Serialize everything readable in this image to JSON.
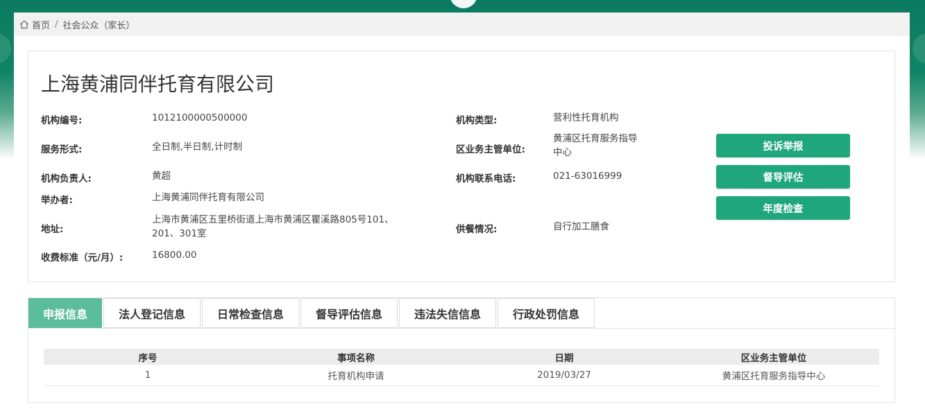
{
  "breadcrumb": {
    "home": "首页",
    "separator": "/",
    "current": "社会公众（家长）"
  },
  "org": {
    "name": "上海黄浦同伴托育有限公司",
    "fields_left": [
      {
        "label": "机构编号:",
        "value": "1012100000500000"
      },
      {
        "label": "服务形式:",
        "value": "全日制,半日制,计时制"
      },
      {
        "label": "机构负责人:",
        "value": "黄超"
      },
      {
        "label": "举办者:",
        "value": "上海黄浦同伴托育有限公司"
      },
      {
        "label": "地址:",
        "value_line1": "上海市黄浦区五里桥街道上海市黄浦区瞿溪路805号101、",
        "value_line2": "201、301室"
      },
      {
        "label": "收费标准（元/月）:",
        "value": "16800.00"
      }
    ],
    "fields_right": [
      {
        "label": "机构类型:",
        "value": "营利性托育机构"
      },
      {
        "label": "区业务主管单位:",
        "value_line1": "黄浦区托育服务指导",
        "value_line2": "中心"
      },
      {
        "label": "机构联系电话:",
        "value": "021-63016999"
      },
      {
        "label": "供餐情况:",
        "value": "自行加工膳食"
      }
    ]
  },
  "actions": {
    "complaint": "投诉举报",
    "supervision": "督导评估",
    "annual": "年度检查"
  },
  "tabs": [
    {
      "label": "申报信息",
      "active": true
    },
    {
      "label": "法人登记信息",
      "active": false
    },
    {
      "label": "日常检查信息",
      "active": false
    },
    {
      "label": "督导评估信息",
      "active": false
    },
    {
      "label": "违法失信信息",
      "active": false
    },
    {
      "label": "行政处罚信息",
      "active": false
    }
  ],
  "table": {
    "headers": [
      "序号",
      "事项名称",
      "日期",
      "区业务主管单位"
    ],
    "rows": [
      [
        "1",
        "托育机构申请",
        "2019/03/27",
        "黄浦区托育服务指导中心"
      ]
    ]
  },
  "colors": {
    "accent": "#1fa67a",
    "tab_active": "#5bbd9c",
    "header_bg": "#0b7a5f"
  }
}
